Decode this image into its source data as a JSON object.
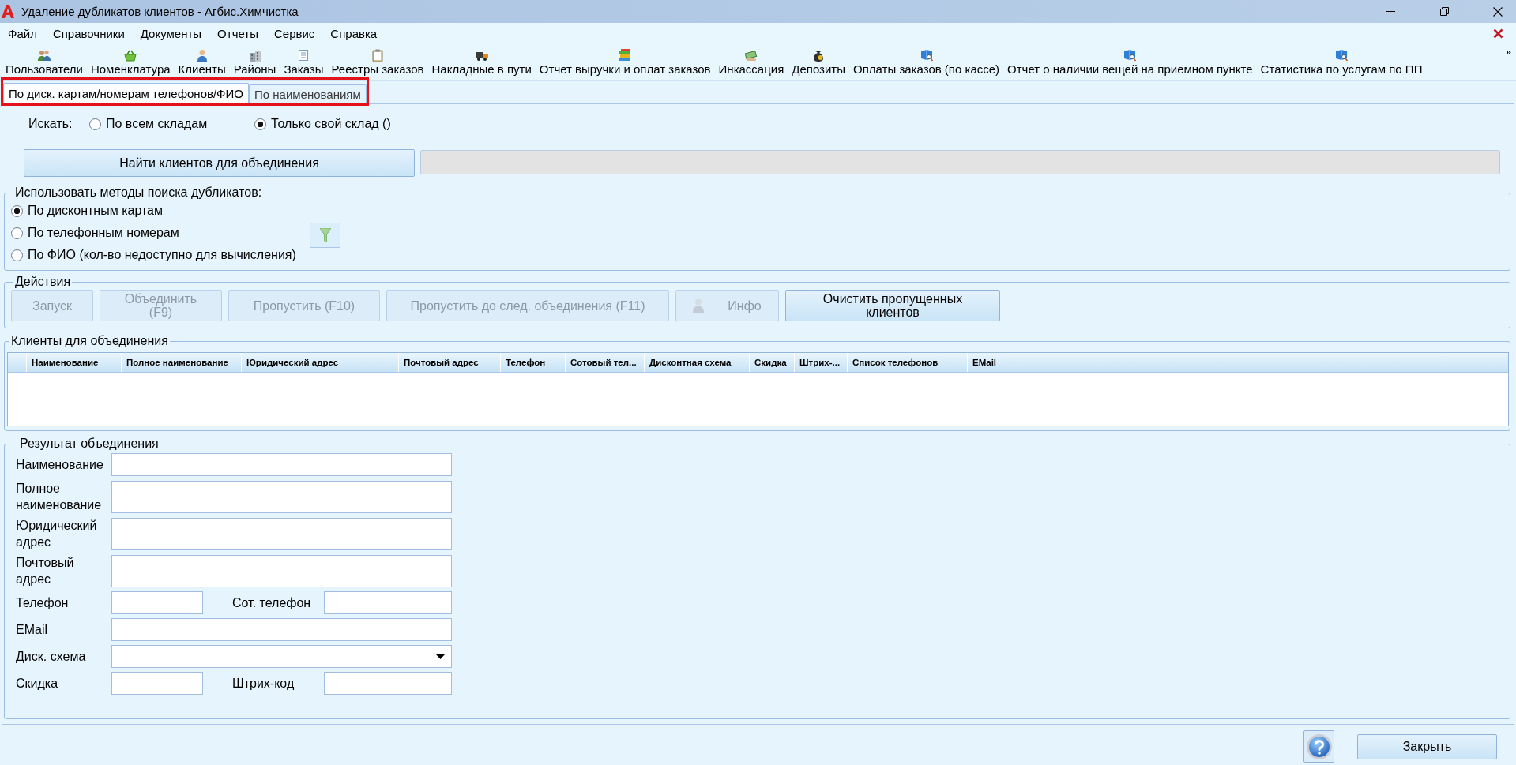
{
  "window": {
    "title": "Удаление дубликатов клиентов - Агбис.Химчистка"
  },
  "menu": [
    "Файл",
    "Справочники",
    "Документы",
    "Отчеты",
    "Сервис",
    "Справка"
  ],
  "toolbar": {
    "items": [
      "Пользователи",
      "Номенклатура",
      "Клиенты",
      "Районы",
      "Заказы",
      "Реестры заказов",
      "Накладные в пути",
      "Отчет выручки и оплат заказов",
      "Инкассация",
      "Депозиты",
      "Оплаты заказов (по кассе)",
      "Отчет о наличии вещей на приемном пункте",
      "Статистика по услугам по ПП"
    ],
    "overflow": "»"
  },
  "tabs": {
    "highlighted": true,
    "items": [
      {
        "label": "По диск. картам/номерам телефонов/ФИО",
        "selected": true
      },
      {
        "label": "По наименованиям",
        "selected": false
      }
    ]
  },
  "search_scope": {
    "label": "Искать:",
    "options": [
      {
        "label": "По всем складам",
        "selected": false
      },
      {
        "label": "Только свой склад ()",
        "selected": true
      }
    ]
  },
  "find_button": "Найти клиентов для объединения",
  "methods": {
    "title": "Использовать методы поиска дубликатов:",
    "options": [
      {
        "label": "По дисконтным картам",
        "selected": true
      },
      {
        "label": "По телефонным номерам",
        "selected": false
      },
      {
        "label": "По ФИО (кол-во недоступно для вычисления)",
        "selected": false
      }
    ]
  },
  "actions": {
    "title": "Действия",
    "buttons": [
      {
        "label": "Запуск",
        "kind": "text",
        "disabled": true
      },
      {
        "label": "Объединить (F9)",
        "kind": "text",
        "disabled": true
      },
      {
        "label": "Пропустить (F10)",
        "kind": "text",
        "disabled": true
      },
      {
        "label": "Пропустить до след. объединения (F11)",
        "kind": "text",
        "disabled": true
      },
      {
        "label": "Инфо",
        "kind": "icon",
        "disabled": true
      },
      {
        "label": "Очистить пропущенных клиентов",
        "kind": "text",
        "disabled": false
      }
    ]
  },
  "clients": {
    "title": "Клиенты для объединения",
    "columns": [
      "Наименование",
      "Полное наименование",
      "Юридический адрес",
      "Почтовый адрес",
      "Телефон",
      "Сотовый тел...",
      "Дисконтная схема",
      "Скидка",
      "Штрих-...",
      "Список телефонов",
      "EMail"
    ]
  },
  "result": {
    "title": "Результат объединения",
    "rows": [
      {
        "fields": [
          {
            "label": "Наименование",
            "kind": "line"
          }
        ]
      },
      {
        "fields": [
          {
            "label": "Полное наименование",
            "kind": "multiline"
          }
        ]
      },
      {
        "fields": [
          {
            "label": "Юридический адрес",
            "kind": "multiline"
          }
        ]
      },
      {
        "fields": [
          {
            "label": "Почтовый адрес",
            "kind": "multiline"
          }
        ]
      },
      {
        "fields": [
          {
            "label": "Телефон",
            "kind": "line"
          },
          {
            "label": "Сот. телефон",
            "kind": "line"
          }
        ]
      },
      {
        "fields": [
          {
            "label": "EMail",
            "kind": "line"
          }
        ]
      },
      {
        "fields": [
          {
            "label": "Диск. схема",
            "kind": "dropdown"
          }
        ]
      },
      {
        "fields": [
          {
            "label": "Скидка",
            "kind": "line"
          },
          {
            "label": "Штрих-код",
            "kind": "line"
          }
        ]
      }
    ]
  },
  "footer": {
    "close_button": "Закрыть"
  }
}
